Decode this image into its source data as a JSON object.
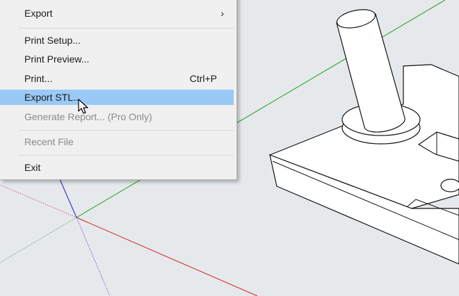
{
  "menu": {
    "items": [
      {
        "label": "Export",
        "has_submenu": true,
        "submenu_arrow": "›",
        "state": "normal"
      },
      {
        "label": "Print Setup...",
        "state": "normal"
      },
      {
        "label": "Print Preview...",
        "state": "normal"
      },
      {
        "label": "Print...",
        "shortcut": "Ctrl+P",
        "state": "normal"
      },
      {
        "label": "Export STL...",
        "state": "highlighted"
      },
      {
        "label": "Generate Report... (Pro Only)",
        "state": "disabled"
      },
      {
        "label": "Recent File",
        "state": "disabled"
      },
      {
        "label": "Exit",
        "state": "normal"
      }
    ]
  },
  "cursor": {
    "icon": "mouse-pointer-icon"
  },
  "viewport": {
    "axis_colors": {
      "x": "#d22020",
      "y": "#1ea01e",
      "z": "#2020c8"
    },
    "model_fill": "#ffffff",
    "model_stroke": "#111111",
    "background": "#e6e9ec"
  },
  "colors": {
    "highlight": "#99c9f5",
    "disabled_text": "#8a8a8a",
    "menu_bg": "#f0f0f0"
  }
}
